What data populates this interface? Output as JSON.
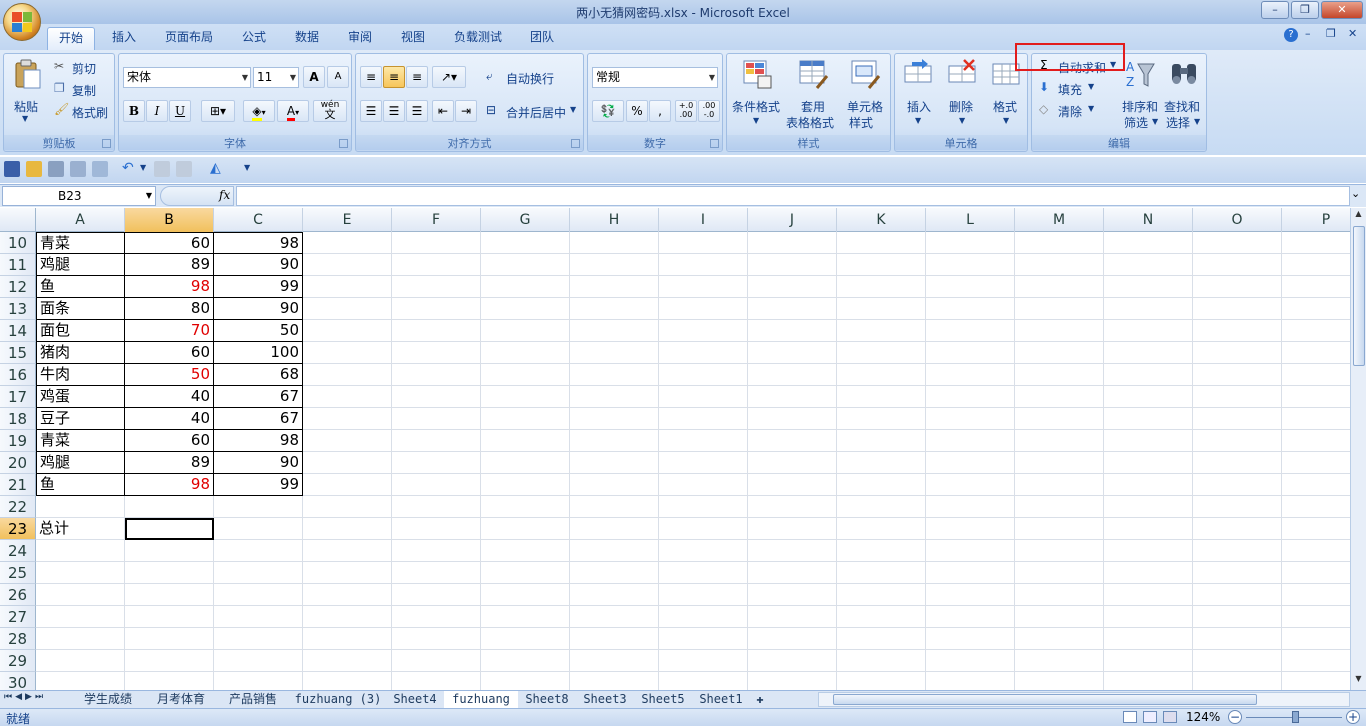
{
  "window": {
    "title": "两小无猜网密码.xlsx - Microsoft Excel",
    "minimize": "–",
    "restore": "❐",
    "close": "✕"
  },
  "ribbon_tabs": [
    "开始",
    "插入",
    "页面布局",
    "公式",
    "数据",
    "审阅",
    "视图",
    "负载测试",
    "团队"
  ],
  "clipboard": {
    "paste": "粘贴",
    "cut": "剪切",
    "copy": "复制",
    "format_painter": "格式刷",
    "caption": "剪贴板"
  },
  "font": {
    "name": "宋体",
    "size": "11",
    "bold": "B",
    "italic": "I",
    "underline": "U",
    "caption": "字体",
    "grow": "A",
    "shrink": "A",
    "wen": "wén",
    "wen_char": "文"
  },
  "alignment": {
    "wrap": "自动换行",
    "merge": "合并后居中",
    "caption": "对齐方式"
  },
  "number": {
    "format": "常规",
    "percent": "%",
    "comma": ",",
    "inc": "←.0\n.00",
    "caption": "数字"
  },
  "styles": {
    "conditional": "条件格式",
    "table_l1": "套用",
    "table_l2": "表格格式",
    "cell_l1": "单元格",
    "cell_l2": "样式",
    "caption": "样式"
  },
  "cells": {
    "insert": "插入",
    "delete": "删除",
    "format": "格式",
    "caption": "单元格"
  },
  "editing": {
    "autosum": "自动求和",
    "fill": "填充",
    "clear": "清除",
    "sort_l1": "排序和",
    "sort_l2": "筛选",
    "find_l1": "查找和",
    "find_l2": "选择",
    "caption": "编辑"
  },
  "name_box": "B23",
  "fx_label": "fx",
  "columns": [
    "A",
    "B",
    "C",
    "E",
    "F",
    "G",
    "H",
    "I",
    "J",
    "K",
    "L",
    "M",
    "N",
    "O",
    "P"
  ],
  "rows": [
    {
      "num": "10",
      "a": "青菜",
      "b": "60",
      "c": "98",
      "b_red": false
    },
    {
      "num": "11",
      "a": "鸡腿",
      "b": "89",
      "c": "90",
      "b_red": false
    },
    {
      "num": "12",
      "a": "鱼",
      "b": "98",
      "c": "99",
      "b_red": true
    },
    {
      "num": "13",
      "a": "面条",
      "b": "80",
      "c": "90",
      "b_red": false
    },
    {
      "num": "14",
      "a": "面包",
      "b": "70",
      "c": "50",
      "b_red": true
    },
    {
      "num": "15",
      "a": "猪肉",
      "b": "60",
      "c": "100",
      "b_red": false
    },
    {
      "num": "16",
      "a": "牛肉",
      "b": "50",
      "c": "68",
      "b_red": true
    },
    {
      "num": "17",
      "a": "鸡蛋",
      "b": "40",
      "c": "67",
      "b_red": false
    },
    {
      "num": "18",
      "a": "豆子",
      "b": "40",
      "c": "67",
      "b_red": false
    },
    {
      "num": "19",
      "a": "青菜",
      "b": "60",
      "c": "98",
      "b_red": false
    },
    {
      "num": "20",
      "a": "鸡腿",
      "b": "89",
      "c": "90",
      "b_red": false
    },
    {
      "num": "21",
      "a": "鱼",
      "b": "98",
      "c": "99",
      "b_red": true
    }
  ],
  "empty_rows": [
    "22",
    "23",
    "24",
    "25",
    "26",
    "27",
    "28",
    "29",
    "30"
  ],
  "total_label": "总计",
  "sheets": [
    "学生成绩",
    "月考体育",
    "产品销售",
    "fuzhuang (3)",
    "Sheet4",
    "fuzhuang",
    "Sheet8",
    "Sheet3",
    "Sheet5",
    "Sheet1"
  ],
  "active_sheet": "fuzhuang",
  "status": {
    "ready": "就绪",
    "zoom": "124%"
  },
  "colors": {
    "accent_red": "#e21c1c",
    "selected_header": "#f1c05c",
    "red_text": "#e00000"
  }
}
